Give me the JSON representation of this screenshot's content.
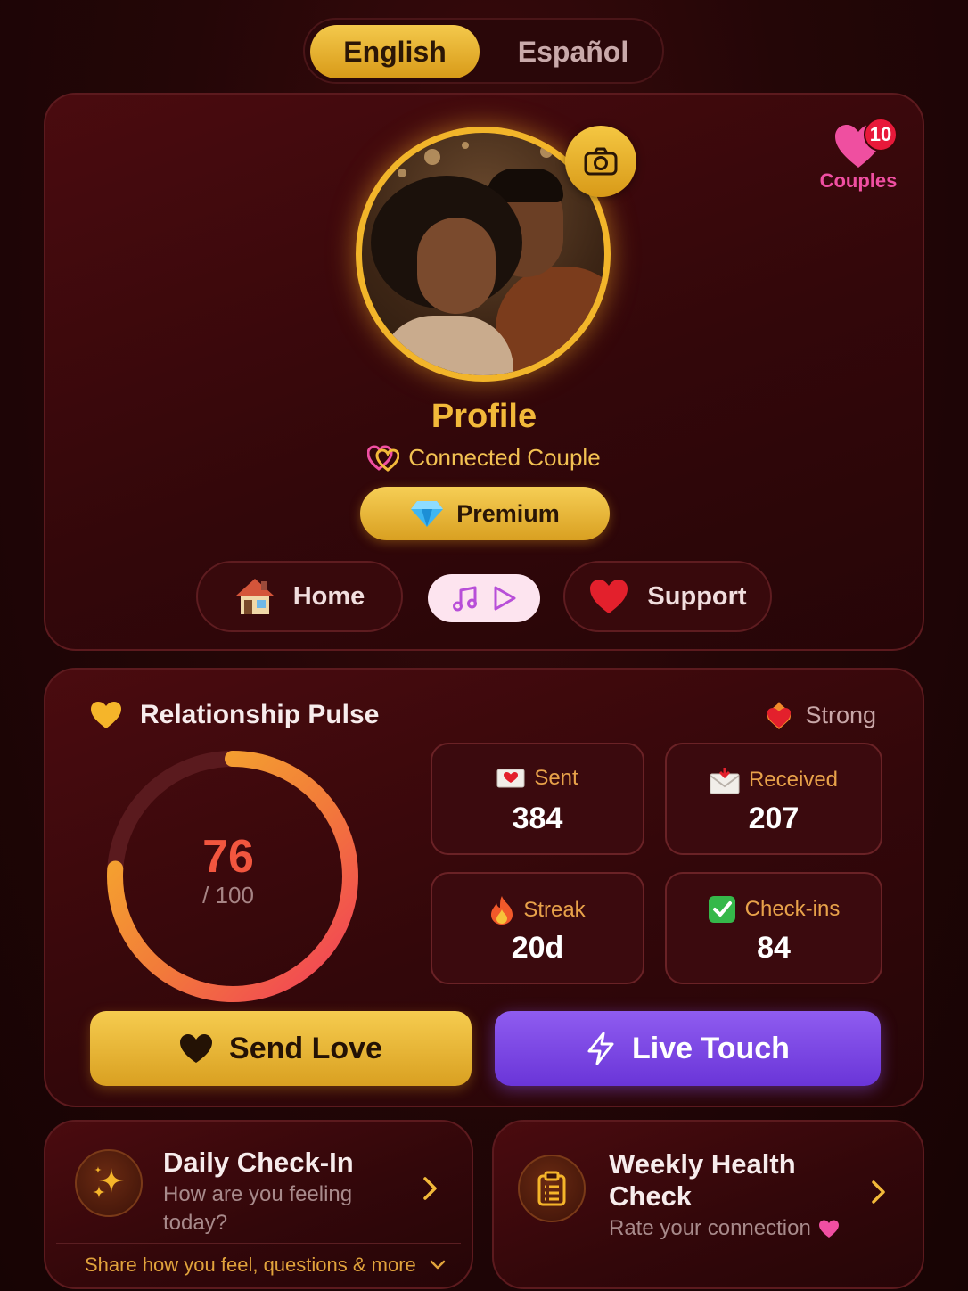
{
  "language": {
    "options": [
      "English",
      "Español"
    ],
    "selected": "English"
  },
  "profile": {
    "title": "Profile",
    "status": "Connected Couple",
    "plan_badge": "Premium",
    "couples": {
      "label": "Couples",
      "count": "10"
    },
    "avatar_description": "couple-photo"
  },
  "quick_nav": {
    "home_label": "Home",
    "support_label": "Support",
    "music_button": "music-play"
  },
  "pulse": {
    "title": "Relationship Pulse",
    "status": "Strong",
    "score": "76",
    "max": "/ 100",
    "score_value": 76,
    "score_max": 100,
    "stats": [
      {
        "label": "Sent",
        "value": "384",
        "icon": "love-letter-icon"
      },
      {
        "label": "Received",
        "value": "207",
        "icon": "inbox-envelope-icon"
      },
      {
        "label": "Streak",
        "value": "20d",
        "icon": "fire-icon"
      },
      {
        "label": "Check-ins",
        "value": "84",
        "icon": "check-mark-icon"
      }
    ],
    "send_love_label": "Send Love",
    "live_touch_label": "Live Touch"
  },
  "daily": {
    "title": "Daily Check-In",
    "subtitle_line1": "How are you feeling",
    "subtitle_line2": "today?",
    "footer": "Share how you feel, questions & more"
  },
  "weekly": {
    "title_line1": "Weekly Health",
    "title_line2": "Check",
    "subtitle": "Rate your connection"
  },
  "colors": {
    "accent_gold": "#f2b93a",
    "accent_purple": "#7a45e6",
    "pink": "#f04fa2",
    "gauge_start": "#f23c5a",
    "gauge_end": "#f5b829"
  }
}
